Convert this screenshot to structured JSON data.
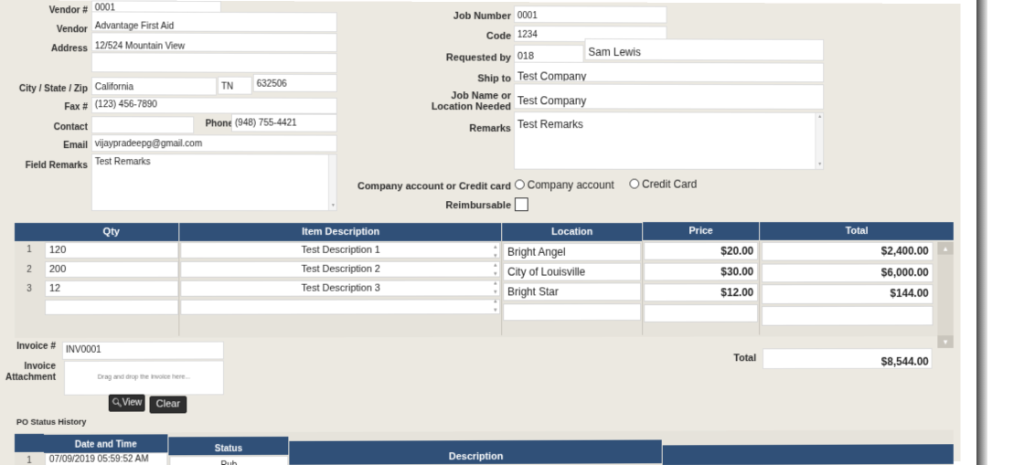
{
  "vendor": {
    "vendor_no_label": "Vendor #",
    "vendor_no": "0001",
    "vendor_label": "Vendor",
    "vendor": "Advantage First Aid",
    "address_label": "Address",
    "address": "12/524 Mountain View",
    "csz_label": "City / State / Zip",
    "city": "California",
    "state": "TN",
    "zip": "632506",
    "fax_label": "Fax #",
    "fax": "(123) 456-7890",
    "contact_label": "Contact",
    "contact": "",
    "phone_label": "Phone",
    "phone": "(948) 755-4421",
    "email_label": "Email",
    "email": "vijaypradeepg@gmail.com",
    "field_remarks_label": "Field Remarks",
    "field_remarks": "Test Remarks"
  },
  "job": {
    "job_number_label": "Job Number",
    "job_number": "0001",
    "code_label": "Code",
    "code": "1234",
    "requested_by_label": "Requested by",
    "requested_by_id": "018",
    "requested_by_name": "Sam Lewis",
    "ship_to_label": "Ship to",
    "ship_to": "Test Company",
    "job_name_label_1": "Job Name or",
    "job_name_label_2": "Location Needed",
    "job_name": "Test Company",
    "remarks_label": "Remarks",
    "remarks": "Test Remarks"
  },
  "payment": {
    "label": "Company account or Credit card",
    "option_company": "Company account",
    "option_credit": "Credit Card",
    "reimbursable_label": "Reimbursable"
  },
  "items": {
    "headers": [
      "Qty",
      "Item Description",
      "Location",
      "Price",
      "Total"
    ],
    "rows": [
      {
        "num": "1",
        "qty": "120",
        "desc": "Test Description 1",
        "location": "Bright Angel",
        "price": "$20.00",
        "total": "$2,400.00"
      },
      {
        "num": "2",
        "qty": "200",
        "desc": "Test Description 2",
        "location": "City of Louisville",
        "price": "$30.00",
        "total": "$6,000.00"
      },
      {
        "num": "3",
        "qty": "12",
        "desc": "Test Description 3",
        "location": "Bright Star",
        "price": "$12.00",
        "total": "$144.00"
      }
    ],
    "grand_total_label": "Total",
    "grand_total": "$8,544.00"
  },
  "invoice": {
    "number_label": "Invoice #",
    "number": "INV0001",
    "attachment_label_1": "Invoice",
    "attachment_label_2": "Attachment",
    "dropzone_text": "Drag and drop the invoice here...",
    "view_label": "View",
    "clear_label": "Clear"
  },
  "status_history": {
    "title": "PO Status History",
    "headers": [
      "Date and Time",
      "Status",
      "Description"
    ],
    "rows": [
      {
        "num": "1",
        "datetime": "07/09/2019 05:59:52 AM",
        "status": "Pub"
      }
    ]
  },
  "icons": {
    "view": "magnifier-icon",
    "scroll_up": "scroll-up-icon",
    "scroll_down": "scroll-down-icon"
  },
  "colors": {
    "header": "#305078",
    "page_bg": "#ece9e1",
    "button": "#2f2f2f"
  }
}
